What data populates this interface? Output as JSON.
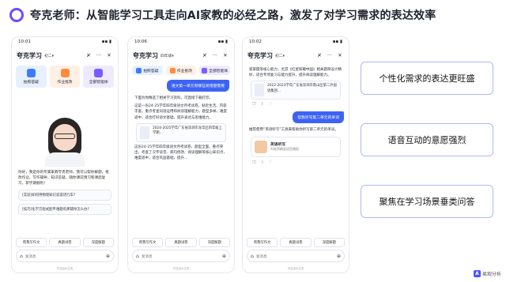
{
  "title": "夸克老师：从智能学习工具走向AI家教的必经之路，激发了对学习需求的表达效率",
  "accent_color": "#6a4cff",
  "phones": [
    {
      "time": "10:01",
      "app_name": "夸克学习",
      "grade": "初二",
      "features": [
        {
          "label": "拍照答疑",
          "icon": "camera-icon"
        },
        {
          "label": "作业批改",
          "icon": "check-icon"
        },
        {
          "label": "全部智能体",
          "icon": "grid-icon"
        }
      ],
      "intro": "你好，我是你的专属家教夸克老师，我可以帮你解题，批改作业，写作辅导，知识答疑，随你课前预习和课后复习，新学期顺利！",
      "questions": [
        "[实验]如何用物理知识说谎话行车?",
        "[技巧]化学方程式配平难题有那辅导怎么办?"
      ],
      "bottom_buttons": [
        "帮我写作文",
        "真题试卷",
        "深度解题"
      ],
      "input_placeholder": "发消息",
      "footnote": "内容由AI生成"
    },
    {
      "time": "10:06",
      "app_name": "夸克学习",
      "grade": "四年级",
      "features": [
        {
          "label": "拍照答疑",
          "icon": "camera-icon"
        },
        {
          "label": "作业批改",
          "icon": "check-icon"
        },
        {
          "label": "全部智能体",
          "icon": "grid-icon"
        }
      ],
      "user_message": "语文第一单元有哪些易错题需要",
      "ai_lines": [
        "下面为你精选了相关学习资料，可直接下载打印。",
        "这是一份24-25学年四年级语文月考试卷，贴近生活、内容丰富，重点考查词语运用和阅读理解能力，题型多样，难度适中，适合打好语文基础，提升表达与思维能力。"
      ],
      "doc_title": "2024-2025学年广东省深圳市龙华区四年级上学期...",
      "ai_lines_2": [
        "这份24-25学年四年级语文月考试卷，题型全面，重点突出，考查了汉字读音、病句修改、阅读理解等核心知识点，难度适中，适合巩固基础，提升..."
      ],
      "bottom_buttons": [
        "帮我写作文",
        "真题试卷",
        "深度解题"
      ],
      "input_placeholder": "发消息",
      "footnote": "内容由AI生成"
    },
    {
      "time": "10:02",
      "app_name": "夸克学习",
      "grade": "初二",
      "ai_top": "容掌握等核心能力，尤其《红星照耀中国》相关题目设计精妙，适合专项复习与能力提升，提升阅读理解能力。",
      "doc_title": "2022-2023学年广东省深圳市南山区第二外国语集团...",
      "user_message": "帮我听写第二单元的单词",
      "ai_lines": [
        "推荐使用“英语听写”工具来帮助你听写第二单元的单词。"
      ],
      "book_name": "英语听写",
      "book_sub": "AI老师精准语音播报",
      "bottom_buttons": [
        "帮我写作文",
        "真题试卷",
        "深度解题"
      ],
      "input_placeholder": "发消息",
      "footnote": "内容由AI生成"
    }
  ],
  "feature_cards": [
    "个性化需求的表达更旺盛",
    "语音互动的意愿强烈",
    "聚焦在学习场景垂类问答"
  ],
  "brand": "易观分析"
}
